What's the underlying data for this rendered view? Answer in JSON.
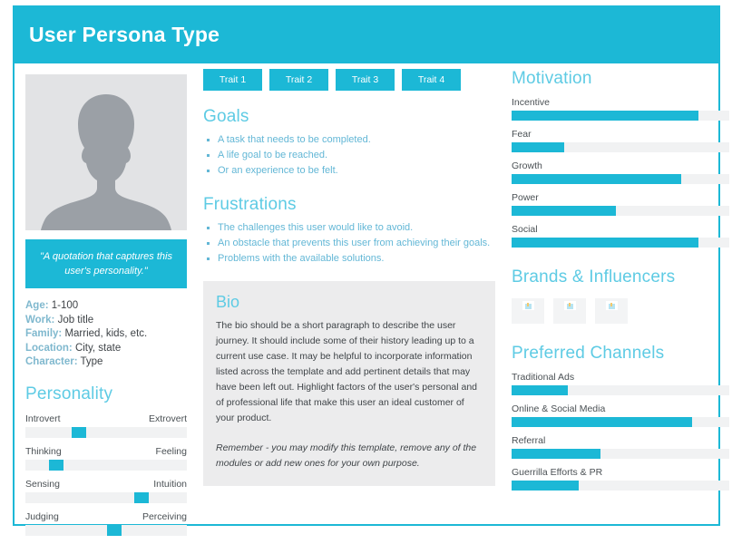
{
  "header": {
    "title": "User Persona Type"
  },
  "avatar": {
    "icon": "person-silhouette-icon"
  },
  "quote": {
    "text": "\"A quotation that captures this user's personality.\""
  },
  "demographics": [
    {
      "label": "Age:",
      "value": " 1-100"
    },
    {
      "label": "Work:",
      "value": " Job title"
    },
    {
      "label": "Family:",
      "value": " Married, kids, etc."
    },
    {
      "label": "Location:",
      "value": " City, state"
    },
    {
      "label": "Character:",
      "value": " Type"
    }
  ],
  "personality": {
    "title": "Personality",
    "sliders": [
      {
        "left": "Introvert",
        "right": "Extrovert",
        "position": 33
      },
      {
        "left": "Thinking",
        "right": "Feeling",
        "position": 19
      },
      {
        "left": "Sensing",
        "right": "Intuition",
        "position": 72
      },
      {
        "left": "Judging",
        "right": "Perceiving",
        "position": 55
      }
    ]
  },
  "traits": [
    {
      "label": "Trait 1"
    },
    {
      "label": "Trait 2"
    },
    {
      "label": "Trait 3"
    },
    {
      "label": "Trait 4"
    }
  ],
  "goals": {
    "title": "Goals",
    "items": [
      "A task that needs to be completed.",
      "A life goal to be reached.",
      "Or an experience to be felt."
    ]
  },
  "frustrations": {
    "title": "Frustrations",
    "items": [
      "The challenges this user would like to avoid.",
      "An obstacle that prevents this user from achieving their goals.",
      "Problems with the available solutions."
    ]
  },
  "bio": {
    "title": "Bio",
    "text": "The bio should be a short paragraph to describe the user journey. It should include some of their history leading up to a current use case. It may be helpful to incorporate information listed across the template and add pertinent details that may have been left out. Highlight factors of the user's personal and of professional life that make this user an ideal customer of your product.",
    "note": "Remember - you may modify this template, remove any of the modules or add new ones for your own purpose."
  },
  "motivation": {
    "title": "Motivation",
    "bars": [
      {
        "label": "Incentive",
        "value": 86
      },
      {
        "label": "Fear",
        "value": 24
      },
      {
        "label": "Growth",
        "value": 78
      },
      {
        "label": "Power",
        "value": 48
      },
      {
        "label": "Social",
        "value": 86
      }
    ]
  },
  "brands": {
    "title": "Brands & Influencers",
    "placeholders": [
      {
        "icon": "image-placeholder-icon"
      },
      {
        "icon": "image-placeholder-icon"
      },
      {
        "icon": "image-placeholder-icon"
      }
    ]
  },
  "channels": {
    "title": "Preferred Channels",
    "bars": [
      {
        "label": "Traditional Ads",
        "value": 26
      },
      {
        "label": "Online & Social Media",
        "value": 83
      },
      {
        "label": "Referral",
        "value": 41
      },
      {
        "label": "Guerrilla Efforts & PR",
        "value": 31
      }
    ]
  },
  "colors": {
    "accent": "#1cb8d6",
    "accent_light": "#5ecbe4",
    "track": "#f1f2f3",
    "bio_bg": "#ececed",
    "avatar_bg": "#e2e3e5"
  }
}
